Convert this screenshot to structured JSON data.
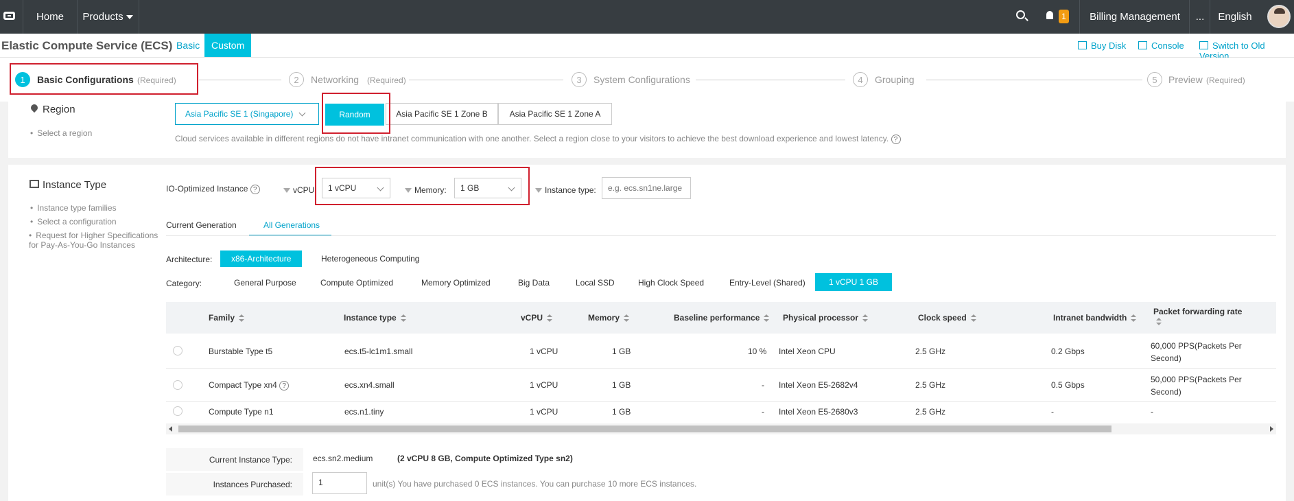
{
  "topbar": {
    "nav": [
      "Home",
      "Products"
    ],
    "notification_count": "1",
    "billing": "Billing Management",
    "more": "...",
    "language": "English"
  },
  "header": {
    "title": "Elastic Compute Service (ECS)",
    "tabs": [
      "Basic",
      "Custom"
    ],
    "links": [
      "Buy Disk",
      "Console",
      "Switch to Old Version"
    ]
  },
  "steps": [
    {
      "num": "1",
      "label": "Basic Configurations",
      "req": "(Required)"
    },
    {
      "num": "2",
      "label": "Networking",
      "req": "(Required)"
    },
    {
      "num": "3",
      "label": "System Configurations",
      "req": ""
    },
    {
      "num": "4",
      "label": "Grouping",
      "req": ""
    },
    {
      "num": "5",
      "label": "Preview",
      "req": "(Required)"
    }
  ],
  "region": {
    "title": "Region",
    "hint": "Select a region",
    "selected_region": "Asia Pacific SE 1 (Singapore)",
    "zones": [
      "Random",
      "Asia Pacific SE 1 Zone B",
      "Asia Pacific SE 1 Zone A"
    ],
    "note": "Cloud services available in different regions do not have intranet communication with one another. Select a region close to your visitors to achieve the best download experience and lowest latency."
  },
  "instance": {
    "title": "Instance Type",
    "hints": [
      "Instance type families",
      "Select a configuration",
      "Request for Higher Specifications for Pay-As-You-Go Instances"
    ],
    "io_label": "IO-Optimized Instance",
    "vcpu_label": "vCPU",
    "vcpu_value": "1 vCPU",
    "memory_label": "Memory:",
    "memory_value": "1 GB",
    "type_label": "Instance type:",
    "type_placeholder": "e.g. ecs.sn1ne.large",
    "gen_tabs": [
      "Current Generation",
      "All Generations"
    ],
    "arch_label": "Architecture:",
    "arch": [
      "x86-Architecture",
      "Heterogeneous Computing"
    ],
    "cat_label": "Category:",
    "categories": [
      "General Purpose",
      "Compute Optimized",
      "Memory Optimized",
      "Big Data",
      "Local SSD",
      "High Clock Speed",
      "Entry-Level (Shared)",
      "1 vCPU 1 GB"
    ]
  },
  "table": {
    "headers": [
      "Family",
      "Instance type",
      "vCPU",
      "Memory",
      "Baseline performance",
      "Physical processor",
      "Clock speed",
      "Intranet bandwidth",
      "Packet forwarding rate"
    ],
    "rows": [
      {
        "family": "Burstable Type t5",
        "type": "ecs.t5-lc1m1.small",
        "vcpu": "1 vCPU",
        "memory": "1 GB",
        "baseline": "10 %",
        "processor": "Intel Xeon CPU",
        "clock": "2.5 GHz",
        "bandwidth": "0.2 Gbps",
        "pps1": "60,000 PPS(Packets Per",
        "pps2": "Second)"
      },
      {
        "family": "Compact Type xn4",
        "type": "ecs.xn4.small",
        "vcpu": "1 vCPU",
        "memory": "1 GB",
        "baseline": "-",
        "processor": "Intel Xeon E5-2682v4",
        "clock": "2.5 GHz",
        "bandwidth": "0.5 Gbps",
        "pps1": "50,000 PPS(Packets Per",
        "pps2": "Second)"
      },
      {
        "family": "Compute Type n1",
        "type": "ecs.n1.tiny",
        "vcpu": "1 vCPU",
        "memory": "1 GB",
        "baseline": "-",
        "processor": "Intel Xeon E5-2680v3",
        "clock": "2.5 GHz",
        "bandwidth": "-",
        "pps1": "-",
        "pps2": ""
      }
    ]
  },
  "summary": {
    "current_label": "Current Instance Type:",
    "current_type": "ecs.sn2.medium",
    "current_desc": "(2 vCPU 8 GB, Compute Optimized Type sn2)",
    "purchased_label": "Instances Purchased:",
    "purchased_value": "1",
    "purchased_note": "unit(s) You have purchased 0 ECS instances. You can purchase 10 more ECS instances."
  }
}
